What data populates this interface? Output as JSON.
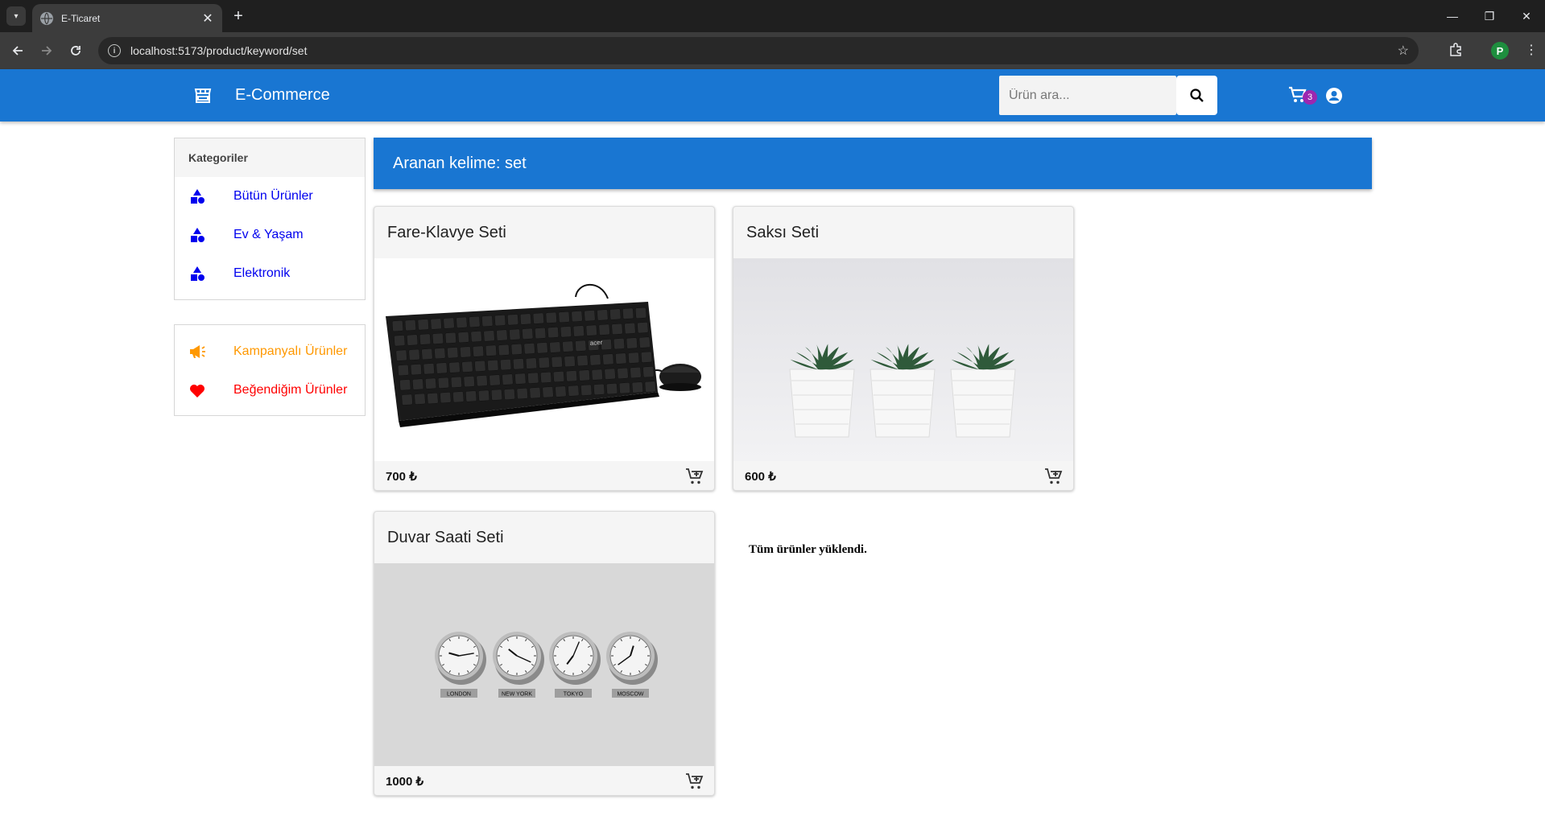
{
  "browser": {
    "tab_title": "E-Ticaret",
    "url": "localhost:5173/product/keyword/set",
    "profile_initial": "P"
  },
  "header": {
    "brand_title": "E-Commerce",
    "search_placeholder": "Ürün ara...",
    "cart_count": "3",
    "accent_color": "#1976d2"
  },
  "sidebar": {
    "categories_title": "Kategoriler",
    "categories": [
      {
        "label": "Bütün Ürünler",
        "icon": "category-shapes-icon"
      },
      {
        "label": "Ev & Yaşam",
        "icon": "category-shapes-icon"
      },
      {
        "label": "Elektronik",
        "icon": "category-shapes-icon"
      }
    ],
    "promos": [
      {
        "label": "Kampanyalı Ürünler",
        "icon": "megaphone-icon",
        "color": "#ff9800"
      },
      {
        "label": "Beğendiğim Ürünler",
        "icon": "heart-icon",
        "color": "#ff0000"
      }
    ]
  },
  "main": {
    "keyword_banner": "Aranan kelime: set",
    "products": [
      {
        "name": "Fare-Klavye Seti",
        "price": "700 ₺",
        "image": "keyboard-mouse-photo"
      },
      {
        "name": "Saksı Seti",
        "price": "600 ₺",
        "image": "succulent-pots-photo"
      },
      {
        "name": "Duvar Saati Seti",
        "price": "1000 ₺",
        "image": "wall-clocks-photo"
      }
    ],
    "clock_labels": [
      "LONDON",
      "NEW YORK",
      "TOKYO",
      "MOSCOW"
    ],
    "keyboard_brand": "acer",
    "loaded_message": "Tüm ürünler yüklendi."
  }
}
